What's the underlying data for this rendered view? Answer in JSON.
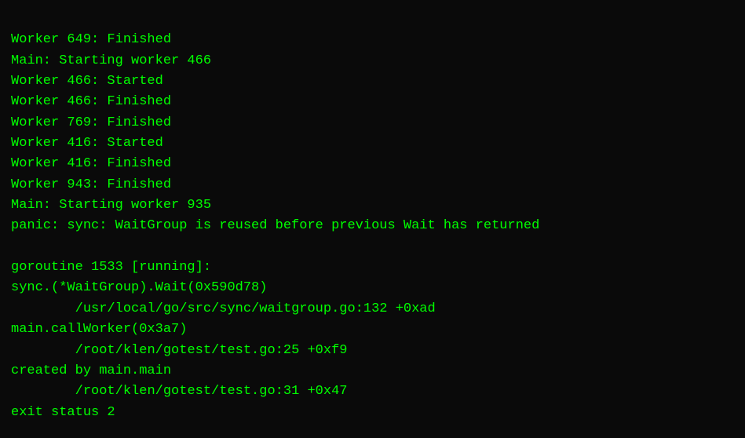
{
  "terminal": {
    "lines": [
      "Worker 649: Finished",
      "Main: Starting worker 466",
      "Worker 466: Started",
      "Worker 466: Finished",
      "Worker 769: Finished",
      "Worker 416: Started",
      "Worker 416: Finished",
      "Worker 943: Finished",
      "Main: Starting worker 935",
      "panic: sync: WaitGroup is reused before previous Wait has returned",
      "",
      "goroutine 1533 [running]:",
      "sync.(*WaitGroup).Wait(0x590d78)",
      "\t/usr/local/go/src/sync/waitgroup.go:132 +0xad",
      "main.callWorker(0x3a7)",
      "\t/root/klen/gotest/test.go:25 +0xf9",
      "created by main.main",
      "\t/root/klen/gotest/test.go:31 +0x47",
      "exit status 2"
    ]
  }
}
